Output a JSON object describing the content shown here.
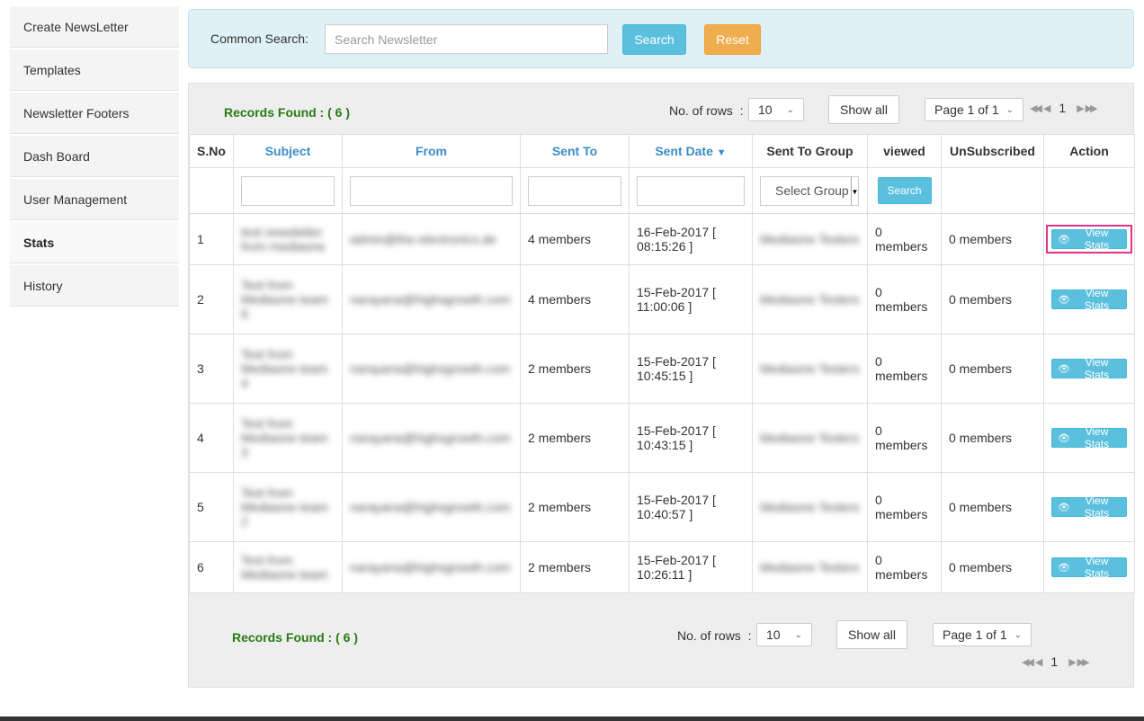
{
  "sidebar": {
    "items": [
      {
        "label": "Create NewsLetter",
        "active": false
      },
      {
        "label": "Templates",
        "active": false
      },
      {
        "label": "Newsletter Footers",
        "active": false
      },
      {
        "label": "Dash Board",
        "active": false
      },
      {
        "label": "User Management",
        "active": false
      },
      {
        "label": "Stats",
        "active": true
      },
      {
        "label": "History",
        "active": false
      }
    ]
  },
  "search": {
    "label": "Common Search:",
    "placeholder": "Search Newsletter",
    "search_button": "Search",
    "reset_button": "Reset"
  },
  "pagination": {
    "records_found": "Records Found : ( 6 )",
    "rows_label": "No. of rows",
    "rows_sep": ":",
    "rows_value": "10",
    "show_all": "Show all",
    "page_label": "Page 1 of 1",
    "current_page": "1"
  },
  "table": {
    "headers": {
      "sno": "S.No",
      "subject": "Subject",
      "from": "From",
      "sent_to": "Sent To",
      "sent_date": "Sent Date",
      "group": "Sent To Group",
      "viewed": "viewed",
      "unsubscribed": "UnSubscribed",
      "action": "Action"
    },
    "filter": {
      "group_placeholder": "Select Group",
      "search_button": "Search"
    },
    "view_label": "View Stats",
    "rows": [
      {
        "sno": "1",
        "subject": "test newsletter from mediaone",
        "from": "admin@the-electronics.de",
        "sent_to": "4 members",
        "date": "16-Feb-2017 [",
        "time": "08:15:26 ]",
        "group": "Mediaone Testers",
        "viewed_a": "0",
        "viewed_b": "members",
        "unsub": "0 members"
      },
      {
        "sno": "2",
        "subject": "Test from Mediaone team 6",
        "from": "narayana@highsgrowth.com",
        "sent_to": "4 members",
        "date": "15-Feb-2017 [",
        "time": "11:00:06 ]",
        "group": "Mediaone Testers",
        "viewed_a": "0",
        "viewed_b": "members",
        "unsub": "0 members"
      },
      {
        "sno": "3",
        "subject": "Test from Mediaone team 4",
        "from": "narayana@highsgrowth.com",
        "sent_to": "2 members",
        "date": "15-Feb-2017 [",
        "time": "10:45:15 ]",
        "group": "Mediaone Testers",
        "viewed_a": "0",
        "viewed_b": "members",
        "unsub": "0 members"
      },
      {
        "sno": "4",
        "subject": "Test from Mediaone team 3",
        "from": "narayana@highsgrowth.com",
        "sent_to": "2 members",
        "date": "15-Feb-2017 [",
        "time": "10:43:15 ]",
        "group": "Mediaone Testers",
        "viewed_a": "0",
        "viewed_b": "members",
        "unsub": "0 members"
      },
      {
        "sno": "5",
        "subject": "Test from Mediaone team 2",
        "from": "narayana@highsgrowth.com",
        "sent_to": "2 members",
        "date": "15-Feb-2017 [",
        "time": "10:40:57 ]",
        "group": "Mediaone Testers",
        "viewed_a": "0",
        "viewed_b": "members",
        "unsub": "0 members"
      },
      {
        "sno": "6",
        "subject": "Test from Mediaone team",
        "from": "narayana@highsgrowth.com",
        "sent_to": "2 members",
        "date": "15-Feb-2017 [",
        "time": "10:26:11 ]",
        "group": "Mediaone Testers",
        "viewed_a": "0",
        "viewed_b": "members",
        "unsub": "0 members"
      }
    ]
  },
  "colors": {
    "accent": "#5bc0de",
    "warning": "#f0ad4e",
    "records_green": "#267c14",
    "sort_blue": "#3a8dc8",
    "highlight": "#e0338c"
  }
}
